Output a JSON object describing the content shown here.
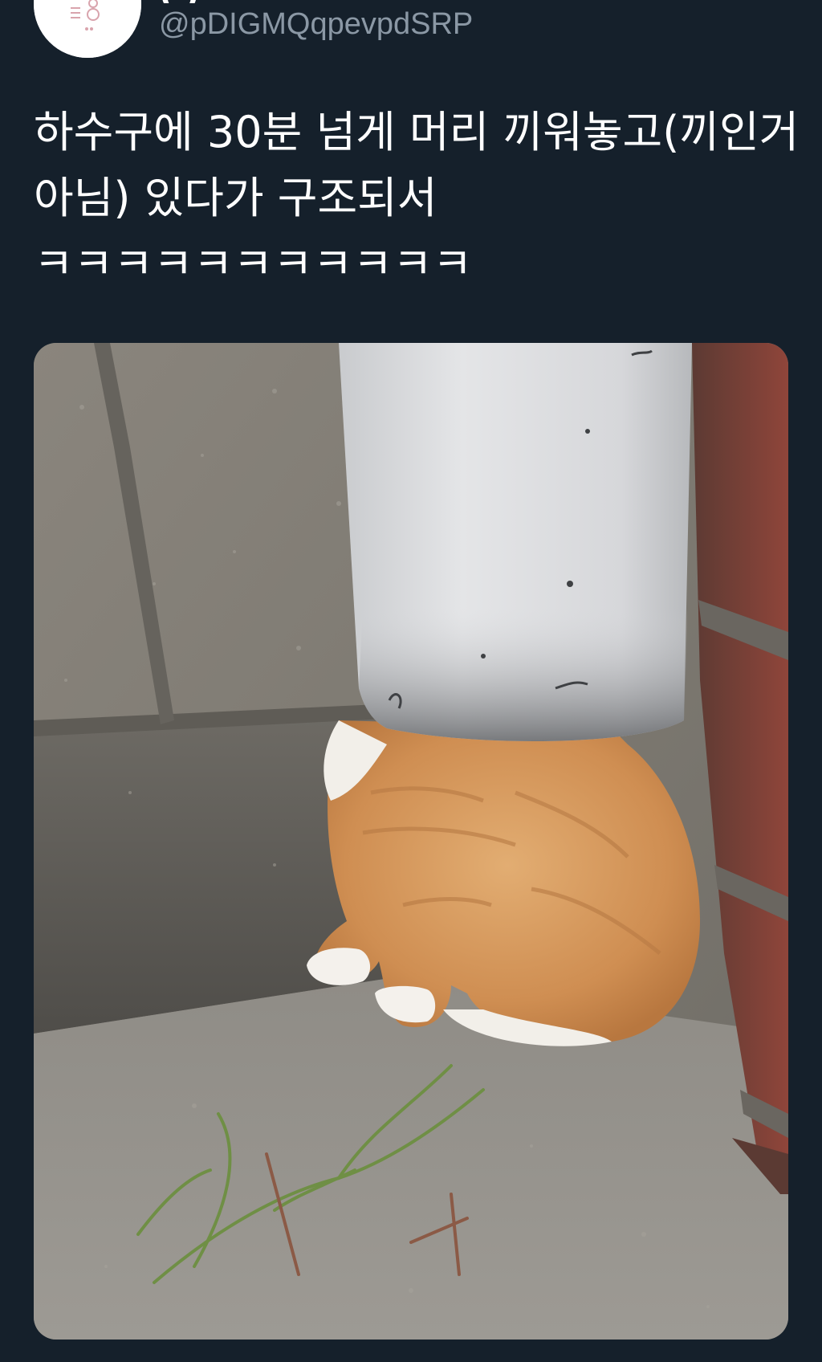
{
  "author": {
    "display_name": "(  )",
    "handle": "@pDIGMQqpevpdSRP",
    "avatar_icon": "profile-avatar-icon"
  },
  "tweet": {
    "text": "하수구에 30분 넘게 머리 끼워놓고(끼인거 아님) 있다가 구조되서 ㅋㅋㅋㅋㅋㅋㅋㅋㅋㅋㅋ"
  },
  "media": {
    "alt_icon": "photo-cat-in-drainpipe",
    "colors": {
      "wall": "#7a7770",
      "pipe": "#d9dbde",
      "cat": "#d89a5c",
      "brick": "#8c3f36",
      "ground": "#8d8a84"
    }
  },
  "theme": {
    "background": "#15202b",
    "secondary_text": "#8b98a5"
  }
}
